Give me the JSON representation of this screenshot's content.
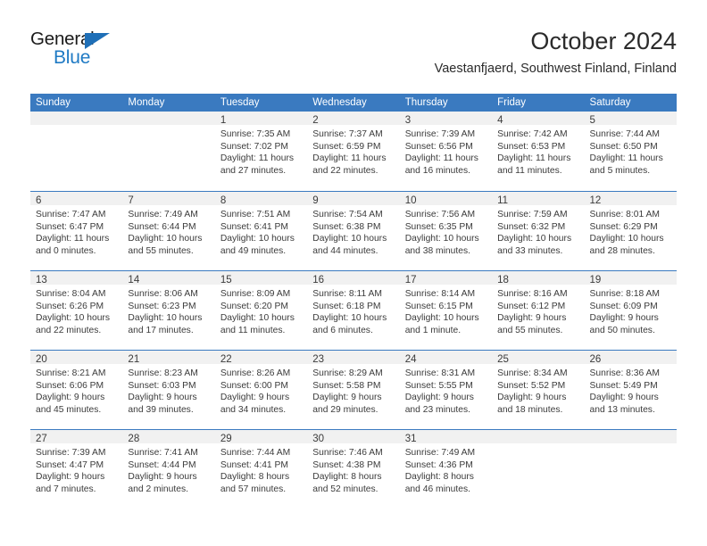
{
  "brand": {
    "name_part1": "General",
    "name_part2": "Blue",
    "color_dark": "#1a1a1a",
    "color_blue": "#1f7ac4"
  },
  "header": {
    "title": "October 2024",
    "subtitle": "Vaestanfjaerd, Southwest Finland, Finland"
  },
  "theme": {
    "header_blue": "#3a7ac0",
    "daynum_band": "#f1f1f1",
    "text": "#3b3b3b"
  },
  "calendar": {
    "weekday_headers": [
      "Sunday",
      "Monday",
      "Tuesday",
      "Wednesday",
      "Thursday",
      "Friday",
      "Saturday"
    ],
    "weeks": [
      [
        {
          "day": "",
          "lines": []
        },
        {
          "day": "",
          "lines": []
        },
        {
          "day": "1",
          "lines": [
            "Sunrise: 7:35 AM",
            "Sunset: 7:02 PM",
            "Daylight: 11 hours",
            "and 27 minutes."
          ]
        },
        {
          "day": "2",
          "lines": [
            "Sunrise: 7:37 AM",
            "Sunset: 6:59 PM",
            "Daylight: 11 hours",
            "and 22 minutes."
          ]
        },
        {
          "day": "3",
          "lines": [
            "Sunrise: 7:39 AM",
            "Sunset: 6:56 PM",
            "Daylight: 11 hours",
            "and 16 minutes."
          ]
        },
        {
          "day": "4",
          "lines": [
            "Sunrise: 7:42 AM",
            "Sunset: 6:53 PM",
            "Daylight: 11 hours",
            "and 11 minutes."
          ]
        },
        {
          "day": "5",
          "lines": [
            "Sunrise: 7:44 AM",
            "Sunset: 6:50 PM",
            "Daylight: 11 hours",
            "and 5 minutes."
          ]
        }
      ],
      [
        {
          "day": "6",
          "lines": [
            "Sunrise: 7:47 AM",
            "Sunset: 6:47 PM",
            "Daylight: 11 hours",
            "and 0 minutes."
          ]
        },
        {
          "day": "7",
          "lines": [
            "Sunrise: 7:49 AM",
            "Sunset: 6:44 PM",
            "Daylight: 10 hours",
            "and 55 minutes."
          ]
        },
        {
          "day": "8",
          "lines": [
            "Sunrise: 7:51 AM",
            "Sunset: 6:41 PM",
            "Daylight: 10 hours",
            "and 49 minutes."
          ]
        },
        {
          "day": "9",
          "lines": [
            "Sunrise: 7:54 AM",
            "Sunset: 6:38 PM",
            "Daylight: 10 hours",
            "and 44 minutes."
          ]
        },
        {
          "day": "10",
          "lines": [
            "Sunrise: 7:56 AM",
            "Sunset: 6:35 PM",
            "Daylight: 10 hours",
            "and 38 minutes."
          ]
        },
        {
          "day": "11",
          "lines": [
            "Sunrise: 7:59 AM",
            "Sunset: 6:32 PM",
            "Daylight: 10 hours",
            "and 33 minutes."
          ]
        },
        {
          "day": "12",
          "lines": [
            "Sunrise: 8:01 AM",
            "Sunset: 6:29 PM",
            "Daylight: 10 hours",
            "and 28 minutes."
          ]
        }
      ],
      [
        {
          "day": "13",
          "lines": [
            "Sunrise: 8:04 AM",
            "Sunset: 6:26 PM",
            "Daylight: 10 hours",
            "and 22 minutes."
          ]
        },
        {
          "day": "14",
          "lines": [
            "Sunrise: 8:06 AM",
            "Sunset: 6:23 PM",
            "Daylight: 10 hours",
            "and 17 minutes."
          ]
        },
        {
          "day": "15",
          "lines": [
            "Sunrise: 8:09 AM",
            "Sunset: 6:20 PM",
            "Daylight: 10 hours",
            "and 11 minutes."
          ]
        },
        {
          "day": "16",
          "lines": [
            "Sunrise: 8:11 AM",
            "Sunset: 6:18 PM",
            "Daylight: 10 hours",
            "and 6 minutes."
          ]
        },
        {
          "day": "17",
          "lines": [
            "Sunrise: 8:14 AM",
            "Sunset: 6:15 PM",
            "Daylight: 10 hours",
            "and 1 minute."
          ]
        },
        {
          "day": "18",
          "lines": [
            "Sunrise: 8:16 AM",
            "Sunset: 6:12 PM",
            "Daylight: 9 hours",
            "and 55 minutes."
          ]
        },
        {
          "day": "19",
          "lines": [
            "Sunrise: 8:18 AM",
            "Sunset: 6:09 PM",
            "Daylight: 9 hours",
            "and 50 minutes."
          ]
        }
      ],
      [
        {
          "day": "20",
          "lines": [
            "Sunrise: 8:21 AM",
            "Sunset: 6:06 PM",
            "Daylight: 9 hours",
            "and 45 minutes."
          ]
        },
        {
          "day": "21",
          "lines": [
            "Sunrise: 8:23 AM",
            "Sunset: 6:03 PM",
            "Daylight: 9 hours",
            "and 39 minutes."
          ]
        },
        {
          "day": "22",
          "lines": [
            "Sunrise: 8:26 AM",
            "Sunset: 6:00 PM",
            "Daylight: 9 hours",
            "and 34 minutes."
          ]
        },
        {
          "day": "23",
          "lines": [
            "Sunrise: 8:29 AM",
            "Sunset: 5:58 PM",
            "Daylight: 9 hours",
            "and 29 minutes."
          ]
        },
        {
          "day": "24",
          "lines": [
            "Sunrise: 8:31 AM",
            "Sunset: 5:55 PM",
            "Daylight: 9 hours",
            "and 23 minutes."
          ]
        },
        {
          "day": "25",
          "lines": [
            "Sunrise: 8:34 AM",
            "Sunset: 5:52 PM",
            "Daylight: 9 hours",
            "and 18 minutes."
          ]
        },
        {
          "day": "26",
          "lines": [
            "Sunrise: 8:36 AM",
            "Sunset: 5:49 PM",
            "Daylight: 9 hours",
            "and 13 minutes."
          ]
        }
      ],
      [
        {
          "day": "27",
          "lines": [
            "Sunrise: 7:39 AM",
            "Sunset: 4:47 PM",
            "Daylight: 9 hours",
            "and 7 minutes."
          ]
        },
        {
          "day": "28",
          "lines": [
            "Sunrise: 7:41 AM",
            "Sunset: 4:44 PM",
            "Daylight: 9 hours",
            "and 2 minutes."
          ]
        },
        {
          "day": "29",
          "lines": [
            "Sunrise: 7:44 AM",
            "Sunset: 4:41 PM",
            "Daylight: 8 hours",
            "and 57 minutes."
          ]
        },
        {
          "day": "30",
          "lines": [
            "Sunrise: 7:46 AM",
            "Sunset: 4:38 PM",
            "Daylight: 8 hours",
            "and 52 minutes."
          ]
        },
        {
          "day": "31",
          "lines": [
            "Sunrise: 7:49 AM",
            "Sunset: 4:36 PM",
            "Daylight: 8 hours",
            "and 46 minutes."
          ]
        },
        {
          "day": "",
          "lines": []
        },
        {
          "day": "",
          "lines": []
        }
      ]
    ]
  }
}
